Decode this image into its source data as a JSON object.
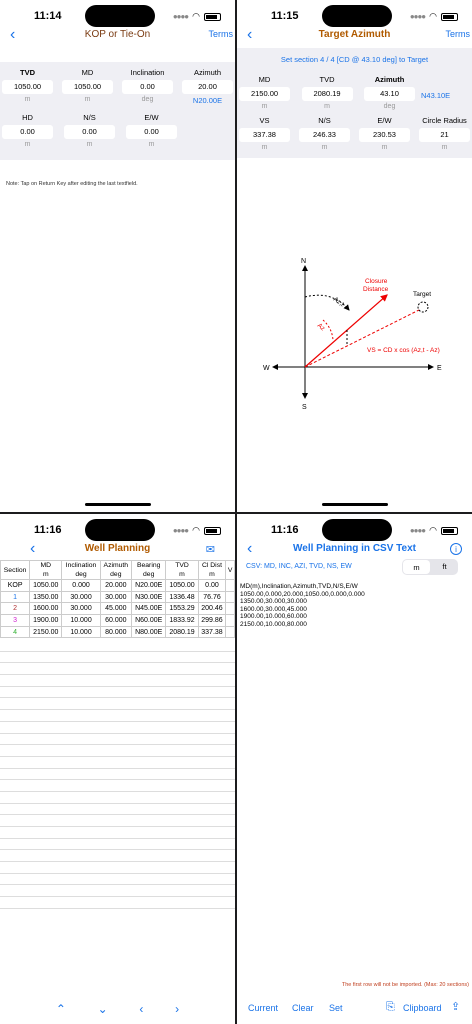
{
  "status": {
    "time1": "11:14",
    "time2": "11:15",
    "time3": "11:16",
    "time4": "11:16"
  },
  "kop": {
    "title": "KOP or Tie-On",
    "terms": "Terms",
    "row1": [
      {
        "label": "TVD",
        "value": "1050.00",
        "unit": "m",
        "bold": true
      },
      {
        "label": "MD",
        "value": "1050.00",
        "unit": "m"
      },
      {
        "label": "Inclination",
        "value": "0.00",
        "unit": "deg"
      },
      {
        "label": "Azimuth",
        "value": "20.00",
        "unit": "N20.00E"
      }
    ],
    "row2": [
      {
        "label": "HD",
        "value": "0.00",
        "unit": "m"
      },
      {
        "label": "N/S",
        "value": "0.00",
        "unit": "m"
      },
      {
        "label": "E/W",
        "value": "0.00",
        "unit": "m"
      }
    ],
    "note": "Note: Tap on Return Key after editing the last textfield."
  },
  "target": {
    "title": "Target Azimuth",
    "terms": "Terms",
    "subtitle": "Set section 4 / 4 [CD @ 43.10 deg] to Target",
    "row1": [
      {
        "label": "MD",
        "value": "2150.00",
        "unit": "m"
      },
      {
        "label": "TVD",
        "value": "2080.19",
        "unit": "m"
      },
      {
        "label": "Azimuth",
        "value": "43.10",
        "unit": "deg",
        "bold": true
      }
    ],
    "az_text": "N43.10E",
    "row2": [
      {
        "label": "VS",
        "value": "337.38",
        "unit": "m"
      },
      {
        "label": "N/S",
        "value": "246.33",
        "unit": "m"
      },
      {
        "label": "E/W",
        "value": "230.53",
        "unit": "m"
      },
      {
        "label": "Circle Radius",
        "value": "21",
        "unit": "m"
      }
    ],
    "diagram": {
      "n": "N",
      "s": "S",
      "e": "E",
      "w": "W",
      "azt": "Az,t",
      "az": "Az",
      "closure1": "Closure",
      "closure2": "Distance",
      "target": "Target",
      "formula": "VS = CD x cos (Az,t - Az)"
    }
  },
  "plan": {
    "title": "Well Planning",
    "headers": [
      [
        "Section",
        ""
      ],
      [
        "MD",
        "m"
      ],
      [
        "Inclination",
        "deg"
      ],
      [
        "Azimuth",
        "deg"
      ],
      [
        "Bearing",
        "deg"
      ],
      [
        "TVD",
        "m"
      ],
      [
        "Cl Dist",
        "m"
      ],
      [
        "V",
        ""
      ]
    ],
    "rows": [
      {
        "sec": "KOP",
        "color": "#000",
        "md": "1050.00",
        "inc": "0.000",
        "az": "20.000",
        "brg": "N20.00E",
        "tvd": "1050.00",
        "cl": "0.00"
      },
      {
        "sec": "1",
        "color": "#1a73e8",
        "md": "1350.00",
        "inc": "30.000",
        "az": "30.000",
        "brg": "N30.00E",
        "tvd": "1336.48",
        "cl": "76.76"
      },
      {
        "sec": "2",
        "color": "#b03030",
        "md": "1600.00",
        "inc": "30.000",
        "az": "45.000",
        "brg": "N45.00E",
        "tvd": "1553.29",
        "cl": "200.46"
      },
      {
        "sec": "3",
        "color": "#d020d0",
        "md": "1900.00",
        "inc": "10.000",
        "az": "60.000",
        "brg": "N60.00E",
        "tvd": "1833.92",
        "cl": "299.86"
      },
      {
        "sec": "4",
        "color": "#30b030",
        "md": "2150.00",
        "inc": "10.000",
        "az": "80.000",
        "brg": "N80.00E",
        "tvd": "2080.19",
        "cl": "337.38"
      }
    ],
    "toolbar": [
      "⌃",
      "⌄",
      "‹",
      "›"
    ]
  },
  "csv": {
    "title": "Well Planning in CSV Text",
    "hint": "CSV: MD, INC, AZI, TVD, NS, EW",
    "seg": [
      "m",
      "ft"
    ],
    "text": "MD(m),Inclination,Azimuth,TVD,N/S,E/W\n1050.00,0.000,20.000,1050.00,0.000,0.000\n1350.00,30.000,30.000\n1600.00,30.000,45.000\n1900.00,10.000,60.000\n2150.00,10.000,80.000",
    "footnote": "The first row will not be imported.  (Max: 20 sections)",
    "buttons": {
      "current": "Current",
      "clear": "Clear",
      "set": "Set",
      "clipboard": "Clipboard"
    }
  }
}
